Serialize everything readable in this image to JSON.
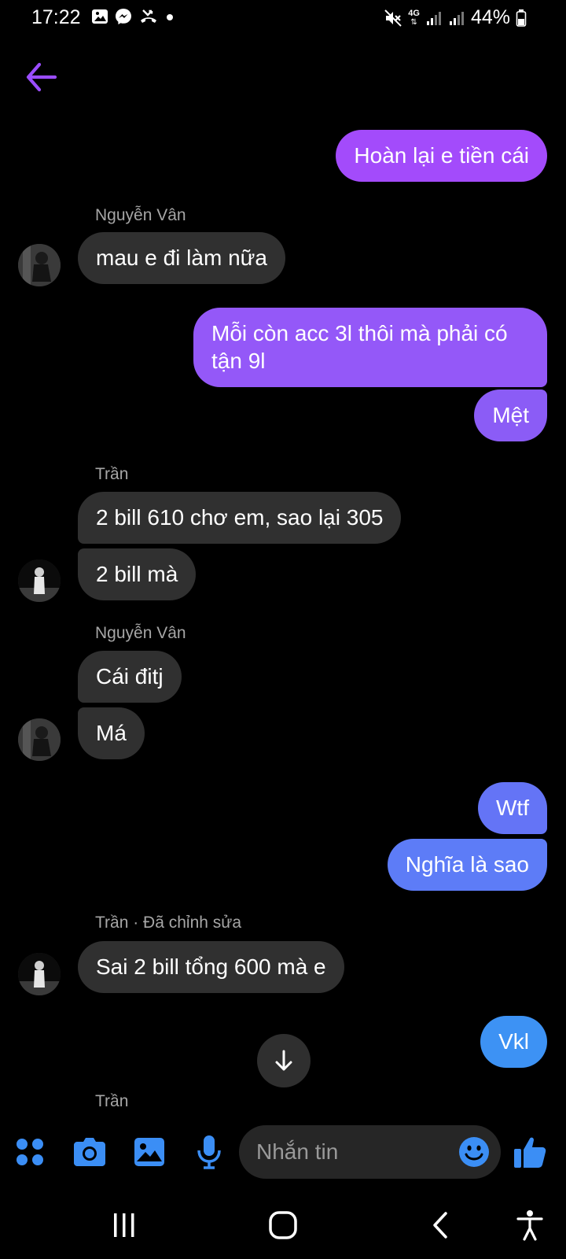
{
  "status_bar": {
    "time": "17:22",
    "network": "4G",
    "battery": "44%"
  },
  "header": {
    "back_icon": "back-arrow-icon",
    "accent_color": "#9b4dff"
  },
  "messages": [
    {
      "direction": "out",
      "text": "Hoàn lại e tiền cái",
      "color": "#a34bfb"
    },
    {
      "direction": "in",
      "sender": "Nguyễn Vân",
      "text": "mau e đi làm nữa"
    },
    {
      "direction": "out",
      "text": "Mỗi còn acc 3l thôi mà phải có tận 9l",
      "color": "#9458f8"
    },
    {
      "direction": "out",
      "text": "Mệt",
      "color": "#8b5cf6"
    },
    {
      "direction": "in",
      "sender": "Trần",
      "text": "2 bill 610 chơ em, sao lại 305"
    },
    {
      "direction": "in",
      "text": "2 bill mà"
    },
    {
      "direction": "in",
      "sender": "Nguyễn Vân",
      "text": "Cái đitj"
    },
    {
      "direction": "in",
      "text": "Má"
    },
    {
      "direction": "out",
      "text": "Wtf",
      "color": "#6474f6"
    },
    {
      "direction": "out",
      "text": "Nghĩa là sao",
      "color": "#5d7cf7"
    },
    {
      "direction": "in",
      "sender": "Trần · Đã chỉnh sửa",
      "text": "Sai 2 bill tổng 600 mà e"
    },
    {
      "direction": "out",
      "text": "Vkl",
      "color": "#3d92f4"
    }
  ],
  "typing_sender": "Trần",
  "composer": {
    "placeholder": "Nhắn tin",
    "icons": [
      "apps-icon",
      "camera-icon",
      "gallery-icon",
      "microphone-icon",
      "emoji-icon",
      "thumbs-up-icon"
    ],
    "icon_color": "#3b8ef5"
  },
  "nav_bar": {
    "icons": [
      "recent-apps-icon",
      "home-icon",
      "back-icon",
      "accessibility-icon"
    ]
  }
}
